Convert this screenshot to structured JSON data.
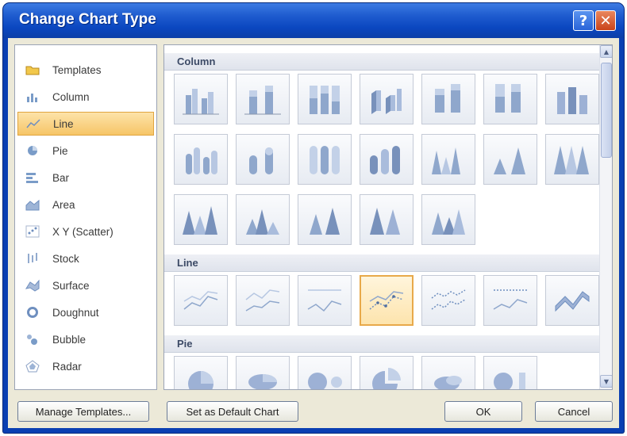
{
  "window": {
    "title": "Change Chart Type",
    "help_label": "?",
    "close_label": "✕"
  },
  "categories": [
    {
      "label": "Templates",
      "icon": "templates-icon"
    },
    {
      "label": "Column",
      "icon": "column-chart-icon"
    },
    {
      "label": "Line",
      "icon": "line-chart-icon",
      "selected": true
    },
    {
      "label": "Pie",
      "icon": "pie-chart-icon"
    },
    {
      "label": "Bar",
      "icon": "bar-chart-icon"
    },
    {
      "label": "Area",
      "icon": "area-chart-icon"
    },
    {
      "label": "X Y (Scatter)",
      "icon": "scatter-chart-icon"
    },
    {
      "label": "Stock",
      "icon": "stock-chart-icon"
    },
    {
      "label": "Surface",
      "icon": "surface-chart-icon"
    },
    {
      "label": "Doughnut",
      "icon": "doughnut-chart-icon"
    },
    {
      "label": "Bubble",
      "icon": "bubble-chart-icon"
    },
    {
      "label": "Radar",
      "icon": "radar-chart-icon"
    }
  ],
  "gallery": {
    "sections": [
      {
        "title": "Column"
      },
      {
        "title": "Line"
      },
      {
        "title": "Pie"
      }
    ],
    "selected_thumb": "line-with-markers"
  },
  "buttons": {
    "manage_templates": "Manage Templates...",
    "set_default": "Set as Default Chart",
    "ok": "OK",
    "cancel": "Cancel"
  },
  "scrollbar": {
    "up_arrow": "▲",
    "down_arrow": "▼"
  },
  "colors": {
    "titlebar": "#0b47c0",
    "selection_fill": "#f6c567",
    "selection_border": "#e0a43e"
  }
}
